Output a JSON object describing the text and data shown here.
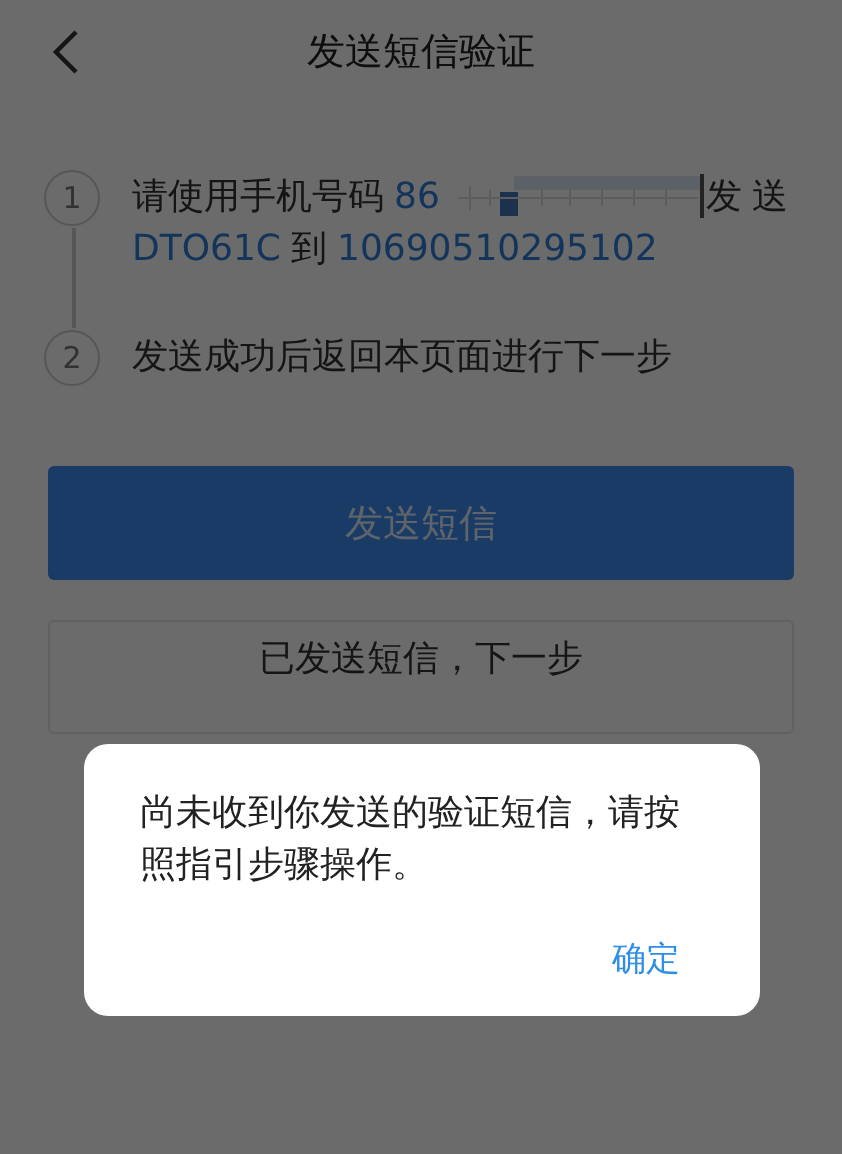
{
  "header": {
    "title": "发送短信验证"
  },
  "steps": [
    {
      "number": "1",
      "segments": [
        {
          "kind": "text",
          "text": "请使用手机号码"
        },
        {
          "kind": "highlight",
          "text": "86"
        },
        {
          "kind": "redacted"
        },
        {
          "kind": "text",
          "text": "发"
        },
        {
          "kind": "text",
          "text": "送"
        },
        {
          "kind": "highlight",
          "text": "DTO61C"
        },
        {
          "kind": "text",
          "text": "到"
        },
        {
          "kind": "highlight",
          "text": "10690510295102"
        }
      ]
    },
    {
      "number": "2",
      "segments": [
        {
          "kind": "text",
          "text": "发送成功后返回本页面进行下一步"
        }
      ]
    }
  ],
  "buttons": [
    {
      "kind": "primary",
      "label": "发送短信"
    },
    {
      "kind": "outline",
      "label": "已发送短信，下一步"
    }
  ],
  "dialog": {
    "message": "尚未收到你发送的验证短信，请按照指引步骤操作。",
    "action": "确定"
  }
}
